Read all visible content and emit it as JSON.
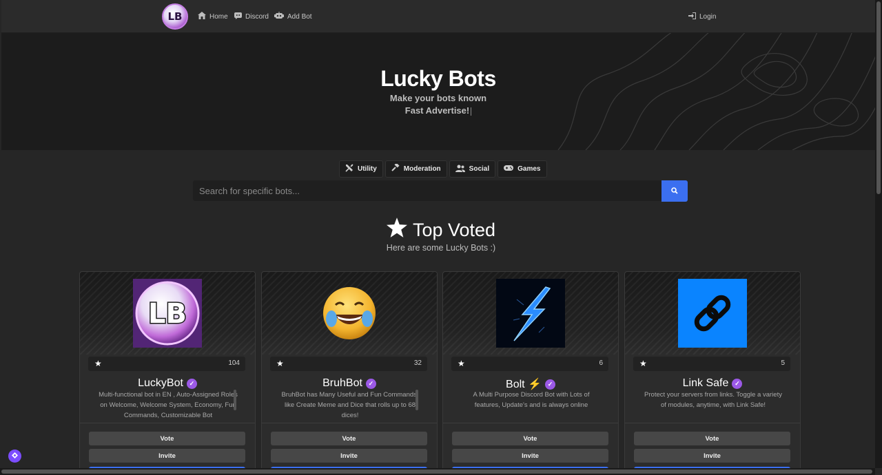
{
  "nav": {
    "logo_text": "LB",
    "items": [
      {
        "label": "Home",
        "icon": "home-icon"
      },
      {
        "label": "Discord",
        "icon": "discord-icon"
      },
      {
        "label": "Add Bot",
        "icon": "robot-icon"
      }
    ],
    "login_label": "Login"
  },
  "hero": {
    "title": "Lucky Bots",
    "line1": "Make your bots known",
    "line2": "Fast Advertise!"
  },
  "categories": [
    {
      "label": "Utility",
      "icon": "tools-icon"
    },
    {
      "label": "Moderation",
      "icon": "hammer-icon"
    },
    {
      "label": "Social",
      "icon": "users-icon"
    },
    {
      "label": "Games",
      "icon": "gamepad-icon"
    }
  ],
  "search": {
    "placeholder": "Search for specific bots..."
  },
  "section": {
    "title": "Top Voted",
    "subtitle": "Here are some Lucky Bots :)"
  },
  "bots": [
    {
      "name": "LuckyBot",
      "votes": "104",
      "description": "Multi-functional bot in EN , Auto-Assigned Roles on Welcome, Welcome System, Economy, Fun Commands, Customizable Bot",
      "avatar": "lb-logo"
    },
    {
      "name": "BruhBot",
      "votes": "32",
      "description": "BruhBot has Many Useful and Fun Commands, like Create Meme and Dice that rolls up to 68 dices!",
      "avatar": "laughing-emoji"
    },
    {
      "name": "Bolt ⚡",
      "votes": "6",
      "description": "A Multi Purpose Discord Bot with Lots of features, Update's and is always online",
      "avatar": "lightning-bolt"
    },
    {
      "name": "Link Safe",
      "votes": "5",
      "description": "Protect your servers from links. Toggle a variety of modules, anytime, with Link Safe!",
      "avatar": "chain-link"
    }
  ],
  "card_buttons": {
    "vote": "Vote",
    "invite": "Invite"
  },
  "colors": {
    "accent": "#3b6ff0",
    "verified": "#9b59e6",
    "background": "#262626"
  }
}
